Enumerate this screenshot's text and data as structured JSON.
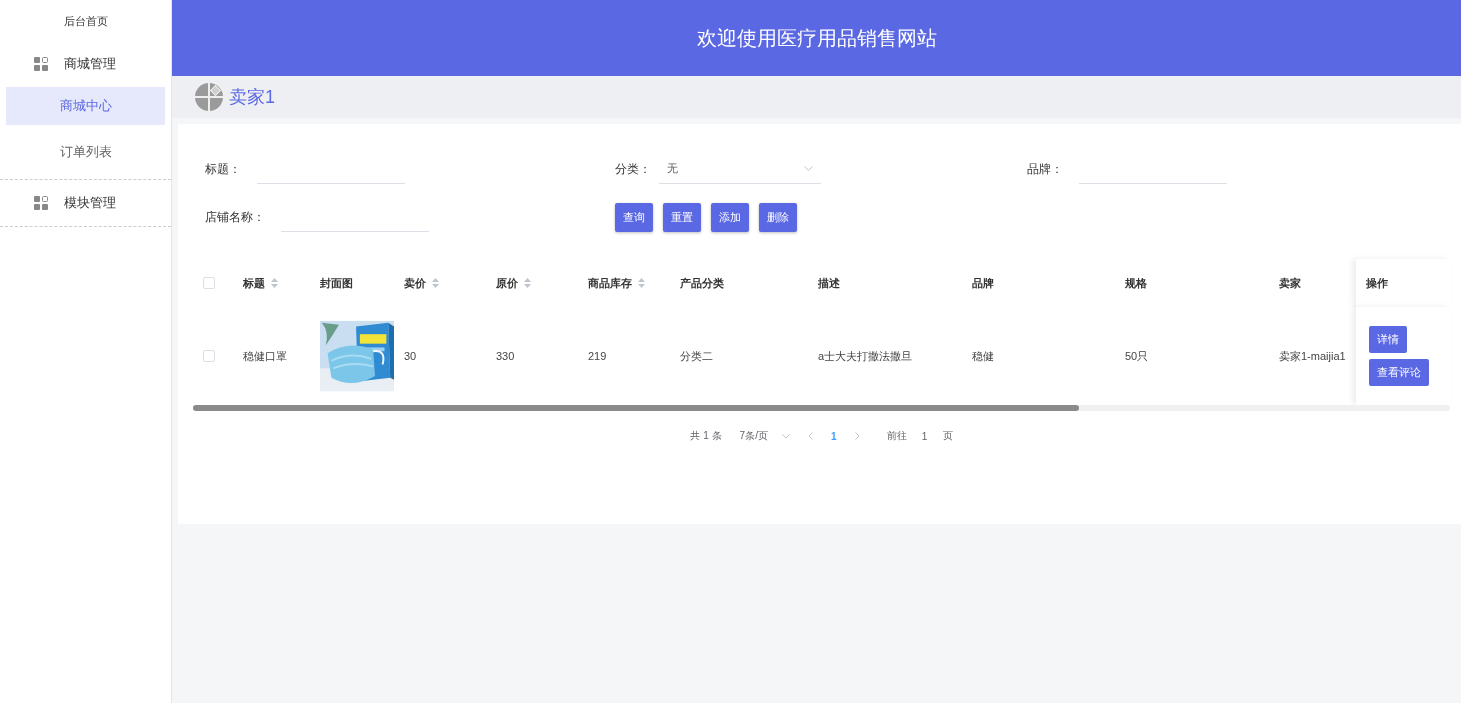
{
  "sidebar": {
    "home": "后台首页",
    "groups": [
      {
        "label": "商城管理",
        "children": [
          {
            "label": "商城中心",
            "selected": true
          },
          {
            "label": "订单列表",
            "selected": false
          }
        ]
      },
      {
        "label": "模块管理"
      }
    ]
  },
  "header": {
    "title": "欢迎使用医疗用品销售网站"
  },
  "user": {
    "name": "卖家1"
  },
  "filters": [
    {
      "kind": "text",
      "label": "标题："
    },
    {
      "kind": "select",
      "label": "分类：",
      "value": "无"
    },
    {
      "kind": "text",
      "label": "品牌："
    },
    {
      "kind": "text",
      "label": "店铺名称："
    }
  ],
  "buttons": [
    "查询",
    "重置",
    "添加",
    "删除"
  ],
  "table": {
    "header_checkbox": {
      "checked": false
    },
    "columns": [
      {
        "label": "标题",
        "sortable": true
      },
      {
        "label": "封面图",
        "sortable": false
      },
      {
        "label": "卖价",
        "sortable": true
      },
      {
        "label": "原价",
        "sortable": true
      },
      {
        "label": "商品库存",
        "sortable": true
      },
      {
        "label": "产品分类",
        "sortable": false
      },
      {
        "label": "描述",
        "sortable": false
      },
      {
        "label": "品牌",
        "sortable": false
      },
      {
        "label": "规格",
        "sortable": false
      },
      {
        "label": "卖家",
        "sortable": false
      },
      {
        "label": "操作",
        "sortable": false
      }
    ],
    "rows": [
      {
        "checked": false,
        "cells": [
          {
            "kind": "text",
            "text": "稳健口罩"
          },
          {
            "kind": "picture"
          },
          {
            "kind": "text",
            "text": "30"
          },
          {
            "kind": "text",
            "text": "330"
          },
          {
            "kind": "text",
            "text": "219"
          },
          {
            "kind": "text",
            "text": "分类二"
          },
          {
            "kind": "text",
            "text": "a士大夫打撒法撒旦"
          },
          {
            "kind": "text",
            "text": "稳健"
          },
          {
            "kind": "text",
            "text": "50只"
          },
          {
            "kind": "text",
            "text": "卖家1-maijia1"
          }
        ],
        "actions": [
          "详情",
          "查看评论"
        ]
      }
    ]
  },
  "pager": {
    "total": "共 1 条",
    "page_size": "7条/页",
    "pages": [
      {
        "label": "1",
        "selected": true
      }
    ],
    "goto_label": "前往",
    "goto_value": "1",
    "page_unit": "页"
  }
}
